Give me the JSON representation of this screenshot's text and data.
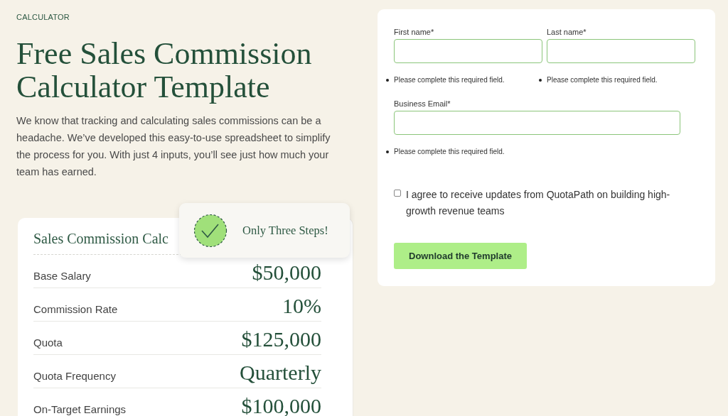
{
  "eyebrow": "CALCULATOR",
  "title": "Free Sales Commission Calculator Template",
  "intro": "We know that tracking and calculating sales commissions can be a headache. We’ve developed this easy-to-use spreadsheet to simplify the process for you. With just 4 inputs, you’ll see just how much your team has earned.",
  "calculator": {
    "title": "Sales Commission Calc",
    "rows": [
      {
        "label": "Base Salary",
        "value": "$50,000"
      },
      {
        "label": "Commission Rate",
        "value": "10%"
      },
      {
        "label": "Quota",
        "value": "$125,000"
      },
      {
        "label": "Quota Frequency",
        "value": "Quarterly"
      },
      {
        "label": "On-Target Earnings",
        "value": "$100,000"
      }
    ]
  },
  "badge": {
    "text": "Only Three Steps!"
  },
  "form": {
    "fields": [
      {
        "kind": "half",
        "label": "First name*",
        "error": "Please complete this required field."
      },
      {
        "kind": "half",
        "label": "Last name*",
        "error": "Please complete this required field."
      },
      {
        "kind": "wide",
        "label": "Business Email*",
        "error": "Please complete this required field."
      }
    ],
    "consent": {
      "label": "I agree to receive updates from QuotaPath on building high-growth revenue teams",
      "checked": false
    },
    "submit": "Download the Template"
  }
}
